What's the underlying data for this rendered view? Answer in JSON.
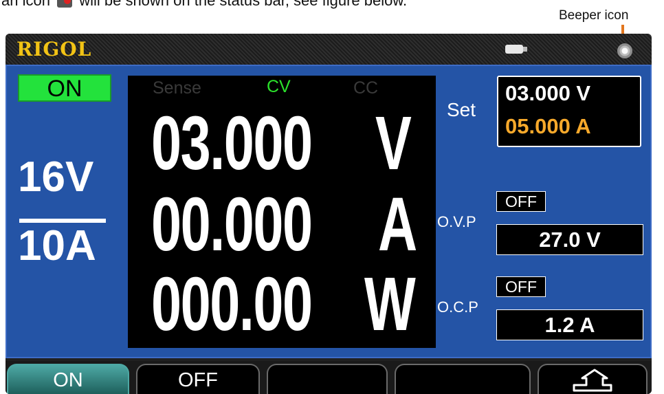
{
  "doc": {
    "text_before": "an icon",
    "text_after": "will be shown on the status bar, see figure below.",
    "callout": "Beeper icon"
  },
  "status_bar": {
    "logo": "RIGOL",
    "logo_color": "#f2c315",
    "icons": [
      "usb-icon",
      "beeper-icon"
    ]
  },
  "left_panel": {
    "output_state": "ON",
    "output_state_color": "#23e23c",
    "range_voltage": "16V",
    "range_current": "10A"
  },
  "readout": {
    "mode_labels": {
      "sense": "Sense",
      "cv": "CV",
      "cc": "CC"
    },
    "active_mode_color": "#2be22b",
    "voltage": "03.000",
    "voltage_unit": "V",
    "current": "00.000",
    "current_unit": "A",
    "power": "000.00",
    "power_unit": "W"
  },
  "settings": {
    "label": "Set",
    "voltage": "03.000 V",
    "current": "05.000 A",
    "current_color": "#f7a92b"
  },
  "protection": {
    "ovp_label": "O.V.P",
    "ovp_state": "OFF",
    "ovp_value": "27.0 V",
    "ocp_label": "O.C.P",
    "ocp_state": "OFF",
    "ocp_value": "1.2 A"
  },
  "softkeys": [
    {
      "label": "ON"
    },
    {
      "label": "OFF"
    },
    {
      "label": ""
    },
    {
      "label": ""
    },
    {
      "label": "",
      "icon": "return-arrow-icon"
    }
  ],
  "colors": {
    "screen_bg": "#2454a6",
    "accent_teal": "#4da8a4"
  }
}
